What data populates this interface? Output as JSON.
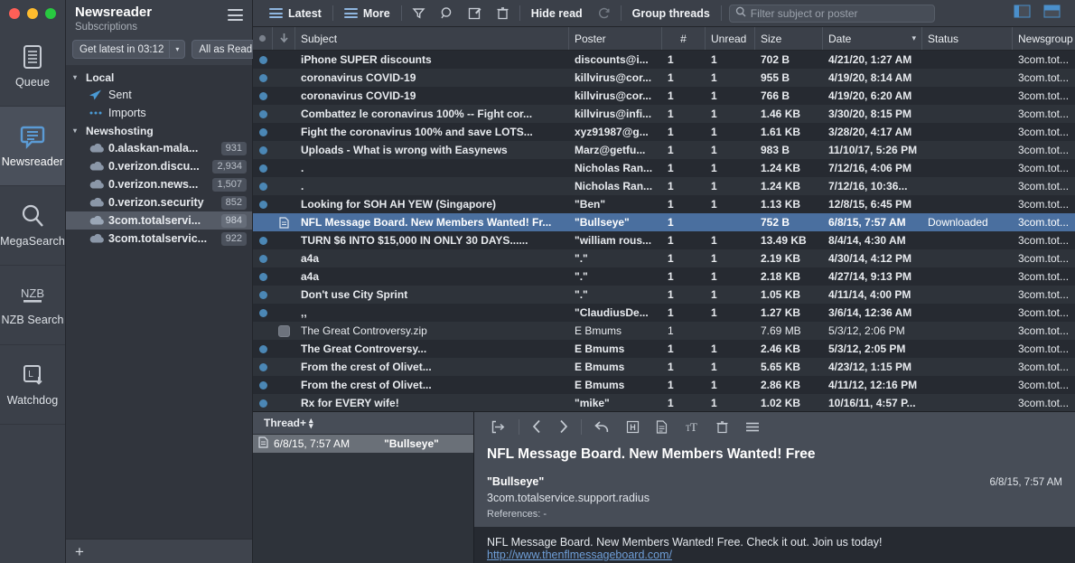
{
  "window": {
    "traffic_lights": [
      "close",
      "minimize",
      "maximize"
    ]
  },
  "rail": {
    "items": [
      {
        "label": "Queue",
        "icon": "queue-list-icon",
        "active": false
      },
      {
        "label": "Newsreader",
        "icon": "newsreader-speech-bubble-icon",
        "active": true
      },
      {
        "label": "MegaSearch",
        "icon": "magnifier-icon",
        "active": false
      },
      {
        "label": "NZB Search",
        "icon": "nzb-icon",
        "active": false
      },
      {
        "label": "Watchdog",
        "icon": "watchdog-download-icon",
        "active": false
      }
    ]
  },
  "sidebar": {
    "title": "Newsreader",
    "subtitle": "Subscriptions",
    "menu_icon": "hamburger-icon",
    "get_latest_label": "Get latest in 03:12",
    "all_as_read_label": "All as Read",
    "add_label": "+",
    "groups": [
      {
        "label": "Local",
        "expanded": true,
        "items": [
          {
            "label": "Sent",
            "icon": "paper-plane-icon",
            "count": ""
          },
          {
            "label": "Imports",
            "icon": "ellipsis-icon",
            "count": ""
          }
        ]
      },
      {
        "label": "Newshosting",
        "expanded": true,
        "items": [
          {
            "label": "0.alaskan-mala...",
            "icon": "cloud-icon",
            "count": "931",
            "selected": false
          },
          {
            "label": "0.verizon.discu...",
            "icon": "cloud-icon",
            "count": "2,934",
            "selected": false
          },
          {
            "label": "0.verizon.news...",
            "icon": "cloud-icon",
            "count": "1,507",
            "selected": false
          },
          {
            "label": "0.verizon.security",
            "icon": "cloud-icon",
            "count": "852",
            "selected": false
          },
          {
            "label": "3com.totalservi...",
            "icon": "cloud-icon",
            "count": "984",
            "selected": true
          },
          {
            "label": "3com.totalservic...",
            "icon": "cloud-icon",
            "count": "922",
            "selected": false
          }
        ]
      }
    ]
  },
  "toolbar": {
    "latest_label": "Latest",
    "more_label": "More",
    "hide_read_label": "Hide read",
    "group_threads_label": "Group threads",
    "icons": [
      "filter-funnel-icon",
      "search-magnifier-icon",
      "compose-pencil-icon",
      "trash-icon",
      "refresh-icon"
    ],
    "search_placeholder": "Filter subject or poster",
    "search_value": "",
    "layout_icons": [
      "layout-side-panel-icon",
      "layout-bottom-panel-icon"
    ]
  },
  "table": {
    "columns": [
      {
        "key": "flag",
        "label": ""
      },
      {
        "key": "arrow",
        "label": ""
      },
      {
        "key": "subject",
        "label": "Subject"
      },
      {
        "key": "poster",
        "label": "Poster"
      },
      {
        "key": "num",
        "label": "#"
      },
      {
        "key": "unread",
        "label": "Unread"
      },
      {
        "key": "size",
        "label": "Size"
      },
      {
        "key": "date",
        "label": "Date",
        "sorted": true
      },
      {
        "key": "status",
        "label": "Status"
      },
      {
        "key": "newsgroup",
        "label": "Newsgroup"
      }
    ],
    "rows": [
      {
        "mark": "dot",
        "subject": "iPhone SUPER discounts",
        "poster": "discounts@i...",
        "num": "1",
        "unread": "1",
        "size": "702 B",
        "date": "4/21/20, 1:27 AM",
        "status": "",
        "newsgroup": "3com.tot..."
      },
      {
        "mark": "dot",
        "subject": "coronavirus COVID-19",
        "poster": "killvirus@cor...",
        "num": "1",
        "unread": "1",
        "size": "955 B",
        "date": "4/19/20, 8:14 AM",
        "status": "",
        "newsgroup": "3com.tot..."
      },
      {
        "mark": "dot",
        "subject": "coronavirus COVID-19",
        "poster": "killvirus@cor...",
        "num": "1",
        "unread": "1",
        "size": "766 B",
        "date": "4/19/20, 6:20 AM",
        "status": "",
        "newsgroup": "3com.tot..."
      },
      {
        "mark": "dot",
        "subject": "Combattez le coronavirus 100% -- Fight cor...",
        "poster": "killvirus@infi...",
        "num": "1",
        "unread": "1",
        "size": "1.46 KB",
        "date": "3/30/20, 8:15 PM",
        "status": "",
        "newsgroup": "3com.tot..."
      },
      {
        "mark": "dot",
        "subject": "Fight the coronavirus 100% and save LOTS...",
        "poster": "xyz91987@g...",
        "num": "1",
        "unread": "1",
        "size": "1.61 KB",
        "date": "3/28/20, 4:17 AM",
        "status": "",
        "newsgroup": "3com.tot..."
      },
      {
        "mark": "dot",
        "subject": "Uploads - What is wrong with Easynews",
        "poster": "Marz@getfu...",
        "num": "1",
        "unread": "1",
        "size": "983 B",
        "date": "11/10/17, 5:26 PM",
        "status": "",
        "newsgroup": "3com.tot..."
      },
      {
        "mark": "dot",
        "subject": ".",
        "poster": "Nicholas Ran...",
        "num": "1",
        "unread": "1",
        "size": "1.24 KB",
        "date": "7/12/16, 4:06 PM",
        "status": "",
        "newsgroup": "3com.tot..."
      },
      {
        "mark": "dot",
        "subject": ".",
        "poster": "Nicholas Ran...",
        "num": "1",
        "unread": "1",
        "size": "1.24 KB",
        "date": "7/12/16, 10:36...",
        "status": "",
        "newsgroup": "3com.tot..."
      },
      {
        "mark": "dot",
        "subject": "Looking for SOH AH YEW (Singapore)",
        "poster": "\"Ben\"",
        "num": "1",
        "unread": "1",
        "size": "1.13 KB",
        "date": "12/8/15, 6:45 PM",
        "status": "",
        "newsgroup": "3com.tot..."
      },
      {
        "mark": "doc",
        "selected": true,
        "subject": "NFL Message Board. New Members Wanted! Fr...",
        "poster": "\"Bullseye\"",
        "num": "1",
        "unread": "",
        "size": "752 B",
        "date": "6/8/15, 7:57 AM",
        "status": "Downloaded",
        "newsgroup": "3com.tot..."
      },
      {
        "mark": "dot",
        "subject": "TURN $6 INTO $15,000 IN ONLY 30 DAYS......",
        "poster": "\"william rous...",
        "num": "1",
        "unread": "1",
        "size": "13.49 KB",
        "date": "8/4/14, 4:30 AM",
        "status": "",
        "newsgroup": "3com.tot..."
      },
      {
        "mark": "dot",
        "subject": "a4a",
        "poster": "\".\"",
        "num": "1",
        "unread": "1",
        "size": "2.19 KB",
        "date": "4/30/14, 4:12 PM",
        "status": "",
        "newsgroup": "3com.tot..."
      },
      {
        "mark": "dot",
        "subject": "a4a",
        "poster": "\".\"",
        "num": "1",
        "unread": "1",
        "size": "2.18 KB",
        "date": "4/27/14, 9:13 PM",
        "status": "",
        "newsgroup": "3com.tot..."
      },
      {
        "mark": "dot",
        "subject": "Don't use City Sprint",
        "poster": "\".\"",
        "num": "1",
        "unread": "1",
        "size": "1.05 KB",
        "date": "4/11/14, 4:00 PM",
        "status": "",
        "newsgroup": "3com.tot..."
      },
      {
        "mark": "dot",
        "subject": ",,",
        "poster": "\"ClaudiusDe...",
        "num": "1",
        "unread": "1",
        "size": "1.27 KB",
        "date": "3/6/14, 12:36 AM",
        "status": "",
        "newsgroup": "3com.tot..."
      },
      {
        "mark": "check",
        "subject": "The Great Controversy.zip",
        "poster": "E Bmums",
        "num": "1",
        "unread": "",
        "size": "7.69 MB",
        "date": "5/3/12, 2:06 PM",
        "status": "",
        "newsgroup": "3com.tot..."
      },
      {
        "mark": "dot",
        "subject": "The Great Controversy...",
        "poster": "E Bmums",
        "num": "1",
        "unread": "1",
        "size": "2.46 KB",
        "date": "5/3/12, 2:05 PM",
        "status": "",
        "newsgroup": "3com.tot..."
      },
      {
        "mark": "dot",
        "subject": "From the crest of Olivet...",
        "poster": "E Bmums",
        "num": "1",
        "unread": "1",
        "size": "5.65 KB",
        "date": "4/23/12, 1:15 PM",
        "status": "",
        "newsgroup": "3com.tot..."
      },
      {
        "mark": "dot",
        "subject": "From the crest of Olivet...",
        "poster": "E Bmums",
        "num": "1",
        "unread": "1",
        "size": "2.86 KB",
        "date": "4/11/12, 12:16 PM",
        "status": "",
        "newsgroup": "3com.tot..."
      },
      {
        "mark": "dot",
        "subject": "Rx for EVERY wife!",
        "poster": "\"mike\"",
        "num": "1",
        "unread": "1",
        "size": "1.02 KB",
        "date": "10/16/11, 4:57 P...",
        "status": "",
        "newsgroup": "3com.tot..."
      }
    ]
  },
  "thread_panel": {
    "header_label": "Thread+",
    "sort_icon": "sort-updown-icon",
    "rows": [
      {
        "icon": "document-icon",
        "date": "6/8/15, 7:57 AM",
        "poster": "\"Bullseye\"",
        "selected": true
      }
    ]
  },
  "detail": {
    "toolbar_icons": [
      "save-to-folder-icon",
      "previous-chevron-icon",
      "next-chevron-icon",
      "reply-arrow-icon",
      "header-h-icon",
      "document-icon",
      "text-format-icon",
      "trash-icon",
      "more-menu-icon"
    ],
    "subject": "NFL Message Board. New Members Wanted! Free",
    "poster": "\"Bullseye\"",
    "date": "6/8/15, 7:57 AM",
    "newsgroup": "3com.totalservice.support.radius",
    "references_label": "References:",
    "references_value": "-",
    "body_line1": "NFL Message Board. New Members Wanted! Free. Check it out. Join us today!",
    "body_link": "http://www.thenflmessageboard.com/"
  },
  "colors": {
    "accent_blue": "#4a6f9f",
    "dot_blue": "#4b87b5",
    "rail_bg": "#3b4049",
    "sidebar_bg": "#31353d",
    "table_bg": "#262a31",
    "table_alt": "#2e333a",
    "panel_bg": "#474d57",
    "icon_blue": "#5b9bd5"
  }
}
